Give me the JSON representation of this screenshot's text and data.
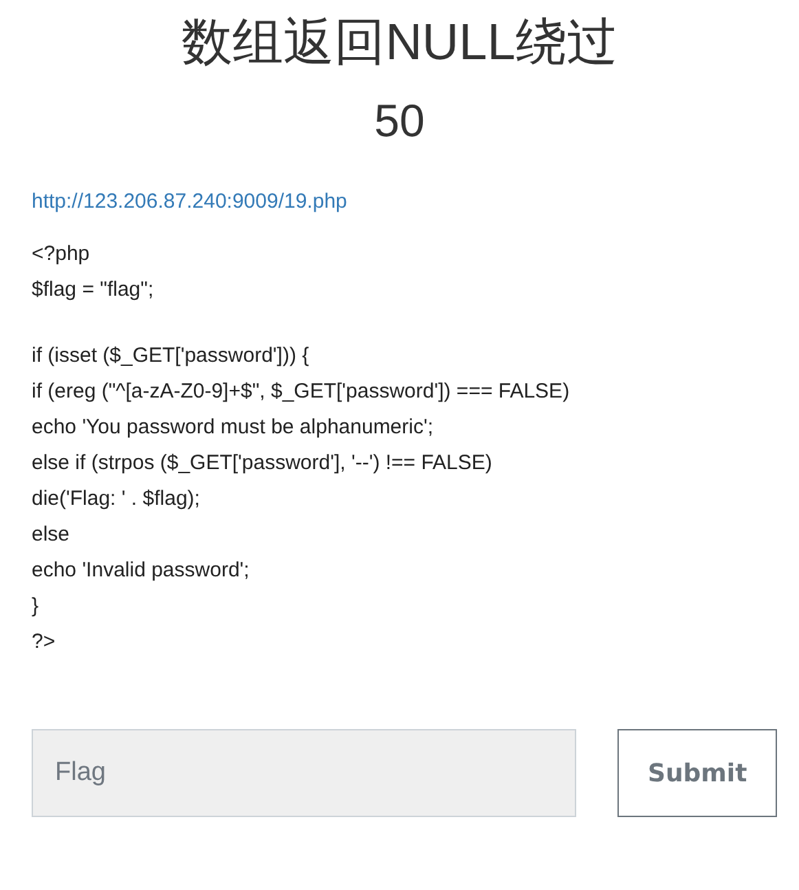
{
  "challenge": {
    "title": "数组返回NULL绕过",
    "points": "50"
  },
  "link": "http://123.206.87.240:9009/19.php",
  "code_blocks": [
    {
      "lines": [
        "<?php",
        "$flag = \"flag\";"
      ]
    },
    {
      "lines": [
        "if (isset ($_GET['password'])) {",
        "if (ereg (\"^[a-zA-Z0-9]+$\", $_GET['password']) === FALSE)",
        "echo 'You password must be alphanumeric';",
        "else if (strpos ($_GET['password'], '--') !== FALSE)",
        "die('Flag: ' . $flag);",
        "else",
        "echo 'Invalid password';",
        "}",
        "?>"
      ]
    }
  ],
  "form": {
    "placeholder": "Flag",
    "button": "Submit"
  }
}
